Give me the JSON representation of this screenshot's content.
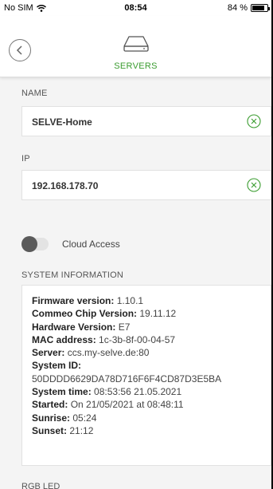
{
  "status_bar": {
    "carrier": "No SIM",
    "time": "08:54",
    "battery": "84 %",
    "battery_level": 0.84
  },
  "header": {
    "title": "SERVERS",
    "icon": "server-icon",
    "back_icon": "chevron-left-icon"
  },
  "name_section": {
    "label": "NAME",
    "value": "SELVE-Home"
  },
  "ip_section": {
    "label": "IP",
    "value": "192.168.178.70"
  },
  "cloud_access": {
    "label": "Cloud Access",
    "enabled": false
  },
  "system_information": {
    "label": "SYSTEM INFORMATION",
    "firmware_label": "Firmware version:",
    "firmware_value": "1.10.1",
    "commeo_label": "Commeo Chip Version:",
    "commeo_value": "19.11.12",
    "hardware_label": "Hardware Version:",
    "hardware_value": "E7",
    "mac_label": "MAC address:",
    "mac_value": "1c-3b-8f-00-04-57",
    "server_label": "Server:",
    "server_value": "ccs.my-selve.de:80",
    "system_id_label": "System ID:",
    "system_id_value": "50DDDD6629DA78D716F6F4CD87D3E5BA",
    "system_time_label": "System time:",
    "system_time_value": "08:53:56 21.05.2021",
    "started_label": "Started:",
    "started_value": "On 21/05/2021 at 08:48:11",
    "sunrise_label": "Sunrise:",
    "sunrise_value": "05:24",
    "sunset_label": "Sunset:",
    "sunset_value": "21:12"
  },
  "next_section": {
    "label": "RGB LED"
  },
  "colors": {
    "accent": "#3a9c2f",
    "background": "#f4f4f4"
  }
}
